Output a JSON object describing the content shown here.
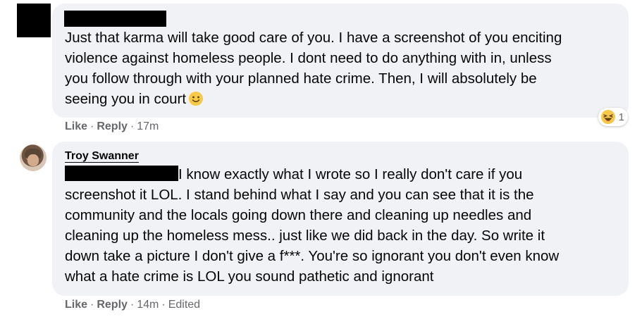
{
  "comments": [
    {
      "author": "",
      "text_lines": [
        "Just that karma will take good care of you. I have a screenshot of you enciting",
        "violence against homeless people. I dont need to do anything with in, unless",
        "you follow through with your planned hate crime. Then, I will absolutely be",
        "seeing you in court"
      ],
      "reaction": {
        "icon": "laughing-face-icon",
        "count": "1"
      },
      "actions": {
        "like": "Like",
        "reply": "Reply",
        "time": "17m"
      }
    },
    {
      "author": "Troy Swanner",
      "text_lines": [
        "I know exactly what I wrote so I really don't care if you",
        "screenshot it LOL. I stand behind what I say and you can see that it is the",
        "community and the locals going down there and cleaning up needles and",
        "cleaning up the homeless mess.. just like we did back in the day. So write it",
        "down take a picture I don't give a f***. You're so ignorant you don't even know",
        "what a hate crime is LOL you sound pathetic and ignorant"
      ],
      "actions": {
        "like": "Like",
        "reply": "Reply",
        "time": "14m",
        "edited": "Edited"
      }
    }
  ],
  "colors": {
    "bubble": "#f0f2f5",
    "meta": "#65676b",
    "text": "#050505"
  }
}
